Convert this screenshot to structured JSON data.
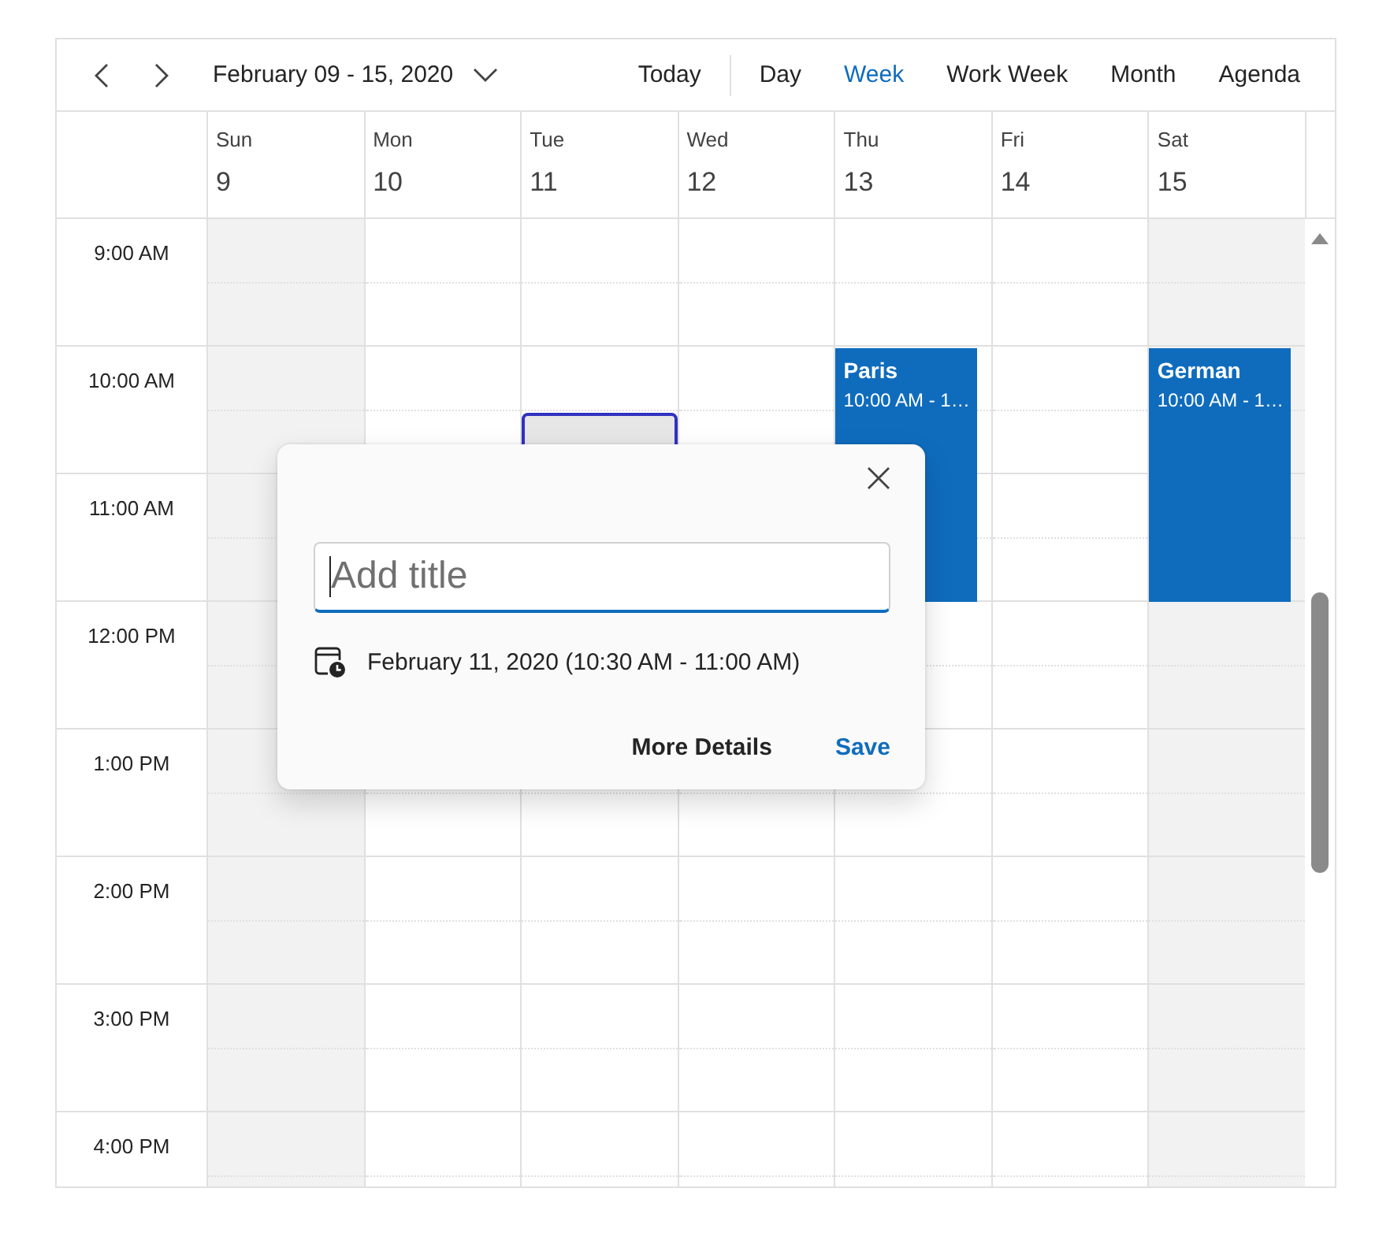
{
  "toolbar": {
    "date_range": "February 09 - 15, 2020",
    "today": "Today",
    "views": [
      {
        "label": "Day",
        "selected": false
      },
      {
        "label": "Week",
        "selected": true
      },
      {
        "label": "Work Week",
        "selected": false
      },
      {
        "label": "Month",
        "selected": false
      },
      {
        "label": "Agenda",
        "selected": false
      }
    ]
  },
  "days": [
    {
      "name": "Sun",
      "date": "9",
      "weekend": true,
      "selected": false
    },
    {
      "name": "Mon",
      "date": "10",
      "weekend": false,
      "selected": false
    },
    {
      "name": "Tue",
      "date": "11",
      "weekend": false,
      "selected": true
    },
    {
      "name": "Wed",
      "date": "12",
      "weekend": false,
      "selected": false
    },
    {
      "name": "Thu",
      "date": "13",
      "weekend": false,
      "selected": false,
      "events": [
        {
          "title": "Paris",
          "time": "10:00 AM - 1…"
        }
      ]
    },
    {
      "name": "Fri",
      "date": "14",
      "weekend": false,
      "selected": false
    },
    {
      "name": "Sat",
      "date": "15",
      "weekend": true,
      "selected": false,
      "events": [
        {
          "title": "German",
          "time": "10:00 AM - 1…"
        }
      ]
    }
  ],
  "time_slots": [
    "9:00 AM",
    "10:00 AM",
    "11:00 AM",
    "12:00 PM",
    "1:00 PM",
    "2:00 PM",
    "3:00 PM",
    "4:00 PM"
  ],
  "quick_popup": {
    "title_field": {
      "placeholder": "Add title",
      "focused": true
    },
    "date_time": "February 11, 2020 (10:30 AM - 11:00 AM)",
    "buttons": [
      {
        "label": "More Details",
        "kind": "secondary"
      },
      {
        "label": "Save",
        "kind": "primary"
      }
    ]
  }
}
